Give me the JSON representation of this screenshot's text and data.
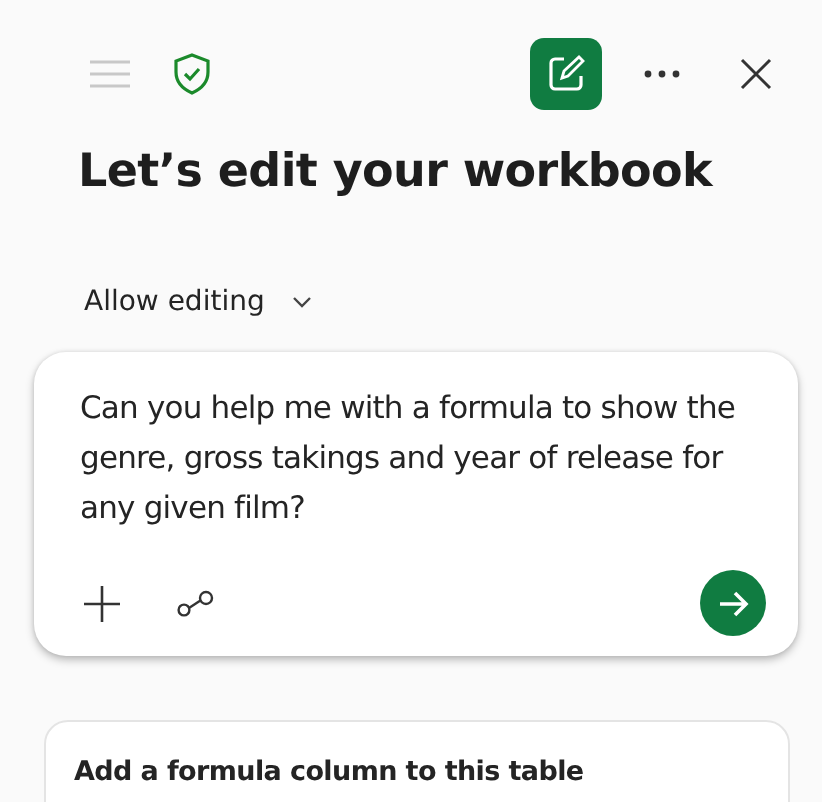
{
  "header": {
    "edit_mode_active": true
  },
  "title": "Let’s edit your workbook",
  "mode_dropdown": {
    "label": "Allow editing"
  },
  "prompt": {
    "value": "Can you help me with a formula to show the genre, gross takings and year of release for any given film?"
  },
  "suggestion": {
    "text": "Add a formula column to this table"
  }
}
